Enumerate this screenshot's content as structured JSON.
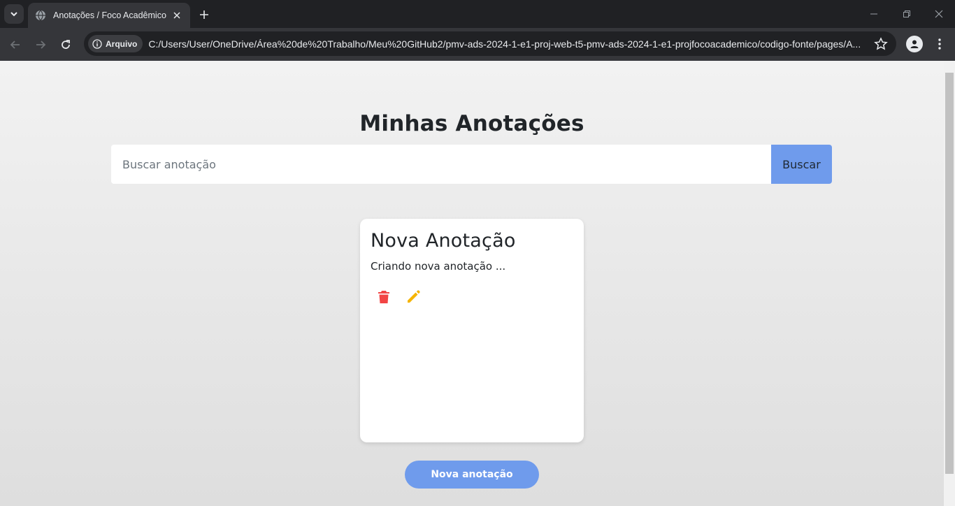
{
  "browser": {
    "tab_title": "Anotações / Foco Acadêmico",
    "security_chip": "Arquivo",
    "url": "C:/Users/User/OneDrive/Área%20de%20Trabalho/Meu%20GitHub2/pmv-ads-2024-1-e1-proj-web-t5-pmv-ads-2024-1-e1-projfocoacademico/codigo-fonte/pages/A..."
  },
  "page": {
    "title": "Minhas Anotações",
    "search": {
      "placeholder": "Buscar anotação",
      "value": ""
    },
    "search_button": "Buscar",
    "notes": [
      {
        "title": "Nova Anotação",
        "body": "Criando nova anotação ..."
      }
    ],
    "new_note_button": "Nova anotação"
  },
  "colors": {
    "accent": "#6f9bec",
    "delete": "#f24444",
    "edit": "#f5b400"
  }
}
